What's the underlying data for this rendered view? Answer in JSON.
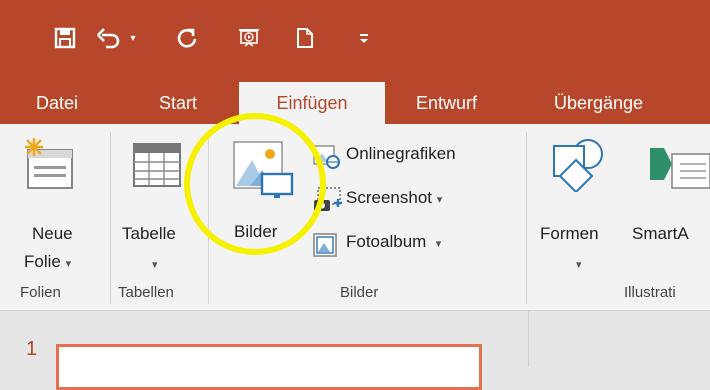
{
  "colors": {
    "accent": "#b7472a",
    "ribbon_bg": "#f3f3f3",
    "highlight": "#f5f100"
  },
  "quick_access": {
    "save_icon": "save-icon",
    "undo_icon": "undo-icon",
    "redo_icon": "redo-icon",
    "presentation_icon": "start-from-beginning-icon",
    "new_icon": "new-document-icon",
    "customize_icon": "customize-qat-icon"
  },
  "tabs": [
    {
      "label": "Datei"
    },
    {
      "label": "Start"
    },
    {
      "label": "Einfügen",
      "active": true
    },
    {
      "label": "Entwurf"
    },
    {
      "label": "Übergänge"
    }
  ],
  "ribbon": {
    "folien": {
      "new_slide_line1": "Neue",
      "new_slide_line2": "Folie",
      "group_label": "Folien"
    },
    "tabellen": {
      "table_label": "Tabelle",
      "group_label": "Tabellen"
    },
    "bilder": {
      "pictures_label": "Bilder",
      "online_pictures_label": "Onlinegrafiken",
      "screenshot_label": "Screenshot",
      "photo_album_label": "Fotoalbum",
      "group_label": "Bilder"
    },
    "illustrationen": {
      "shapes_label": "Formen",
      "smartart_label": "SmartA",
      "group_label": "Illustrati"
    }
  },
  "slides": {
    "first_number": "1"
  }
}
